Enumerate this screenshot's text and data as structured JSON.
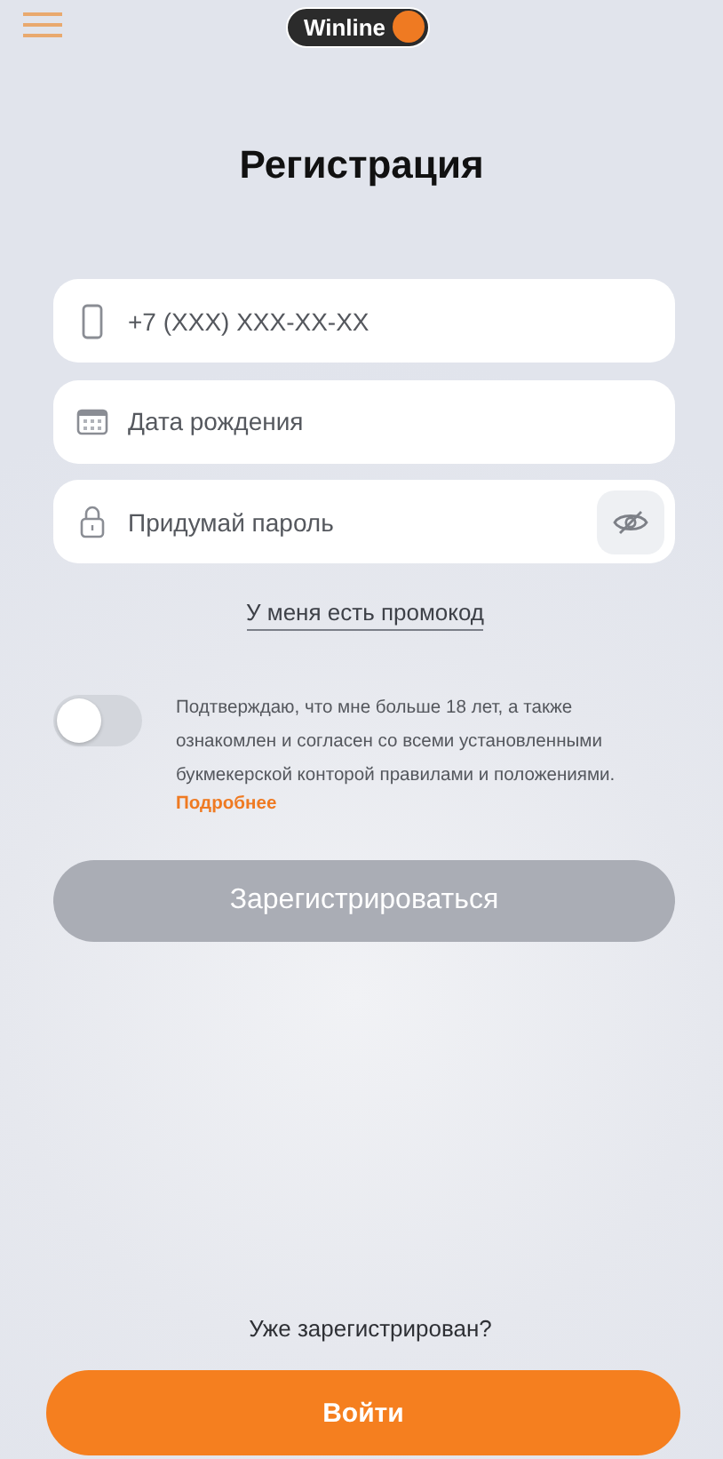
{
  "header": {
    "logo": "Winline"
  },
  "title": "Регистрация",
  "fields": [
    {
      "kind": "phone",
      "placeholder": "+7 (XXX) XXX-XX-XX"
    },
    {
      "kind": "date",
      "placeholder": "Дата рождения"
    },
    {
      "kind": "password",
      "placeholder": "Придумай пароль"
    }
  ],
  "promo_link": "У меня есть промокод",
  "consent": {
    "on": false,
    "text": "Подтверждаю, что мне больше 18 лет, а также ознакомлен и согласен со всеми установленными букмекерской конторой правилами и положениями.",
    "link": "Подробнее"
  },
  "register_button": {
    "label": "Зарегистрироваться",
    "disabled": true
  },
  "login_prompt": "Уже зарегистрирован?",
  "login_button": {
    "label": "Войти"
  }
}
